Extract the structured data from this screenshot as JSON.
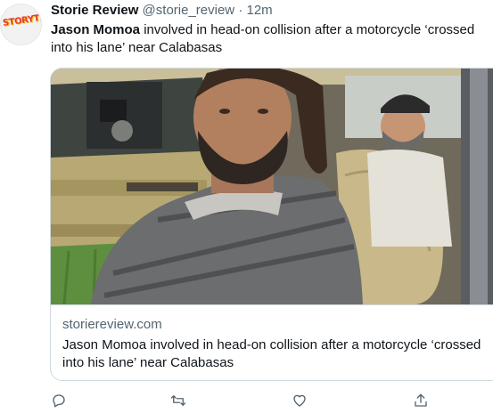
{
  "author": {
    "avatar_text": "STORYTIME",
    "name": "Storie Review",
    "handle": "@storie_review",
    "separator": "·",
    "time": "12m"
  },
  "tweet": {
    "bold_part": "Jason Momoa",
    "rest_text": " involved in head-on collision after a motorcycle ‘crossed into his lane’ near Calabasas"
  },
  "card": {
    "domain": "storiereview.com",
    "title": "Jason Momoa involved in head-on collision after a motorcycle ‘crossed into his lane’ near Calabasas"
  },
  "actions": [
    "reply-icon",
    "retweet-icon",
    "like-icon",
    "share-icon"
  ],
  "colors": {
    "text": "#0f1419",
    "muted": "#536471",
    "border": "#cfd9de"
  }
}
